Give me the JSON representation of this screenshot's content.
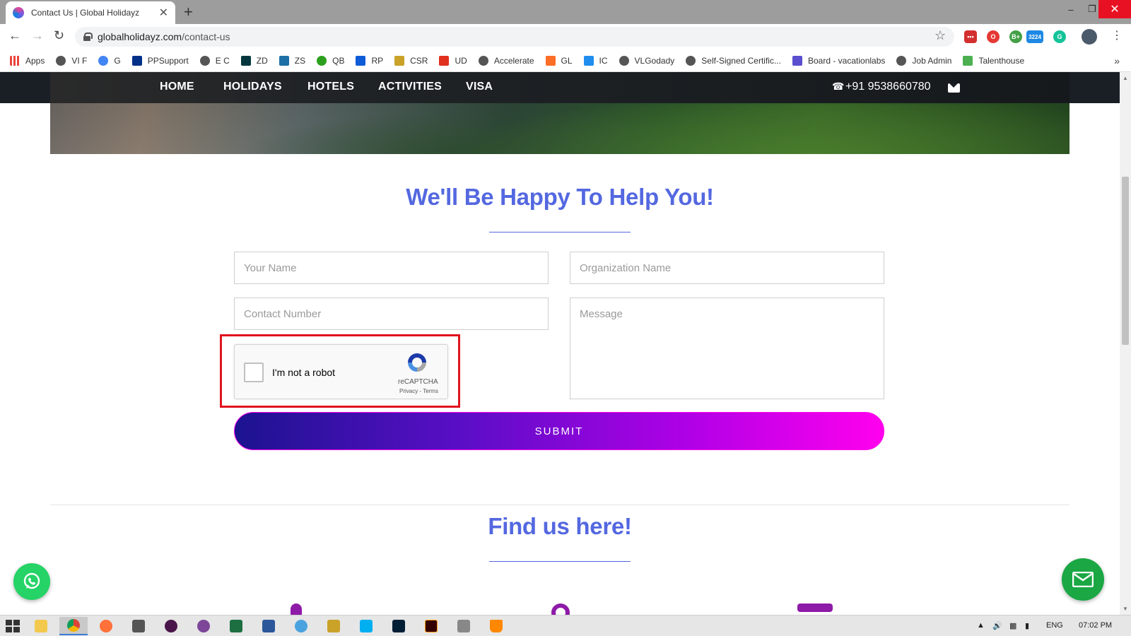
{
  "browser": {
    "tab_title": "Contact Us | Global Holidayz",
    "tab_close": "✕",
    "new_tab": "+",
    "url_domain": "globalholidayz.com",
    "url_path": "/contact-us",
    "window_controls": {
      "minimize": "–",
      "restore": "❐",
      "close": "✕"
    },
    "extension_badge": "3224",
    "bookmarks": [
      {
        "label": "Apps",
        "icon": "apps-grid-icon",
        "color": "#e8453c"
      },
      {
        "label": "VI F",
        "icon": "globe-icon",
        "color": "#555555"
      },
      {
        "label": "G",
        "icon": "google-icon",
        "color": "#4285f4"
      },
      {
        "label": "PPSupport",
        "icon": "paypal-icon",
        "color": "#003087"
      },
      {
        "label": "E C",
        "icon": "globe-icon",
        "color": "#555555"
      },
      {
        "label": "ZD",
        "icon": "zendesk-icon",
        "color": "#03363d"
      },
      {
        "label": "ZS",
        "icon": "zenserp-icon",
        "color": "#1d6fa5"
      },
      {
        "label": "QB",
        "icon": "quickbooks-icon",
        "color": "#2ca01c"
      },
      {
        "label": "RP",
        "icon": "rp-icon",
        "color": "#0e5bd8"
      },
      {
        "label": "CSR",
        "icon": "lock-icon",
        "color": "#c9a227"
      },
      {
        "label": "UD",
        "icon": "ud-icon",
        "color": "#e0301e"
      },
      {
        "label": "Accelerate",
        "icon": "globe-icon",
        "color": "#555555"
      },
      {
        "label": "GL",
        "icon": "gitlab-icon",
        "color": "#fc6d26"
      },
      {
        "label": "IC",
        "icon": "intercom-icon",
        "color": "#1f8ded"
      },
      {
        "label": "VLGodady",
        "icon": "globe-icon",
        "color": "#555555"
      },
      {
        "label": "Self-Signed Certific...",
        "icon": "globe-icon",
        "color": "#555555"
      },
      {
        "label": "Board - vacationlabs",
        "icon": "z-icon",
        "color": "#5a4fcf"
      },
      {
        "label": "Job Admin",
        "icon": "globe-icon",
        "color": "#555555"
      },
      {
        "label": "Talenthouse",
        "icon": "talenthouse-icon",
        "color": "#4caf50"
      }
    ],
    "bookmarks_more": "»"
  },
  "nav": {
    "items": [
      "HOME",
      "HOLIDAYS",
      "HOTELS",
      "ACTIVITIES",
      "VISA"
    ],
    "phone": "+91 9538660780"
  },
  "contact": {
    "heading": "We'll Be Happy To Help You!",
    "name_placeholder": "Your Name",
    "org_placeholder": "Organization Name",
    "phone_placeholder": "Contact Number",
    "message_placeholder": "Message",
    "submit_label": "SUBMIT",
    "captcha": {
      "label": "I'm not a robot",
      "brand": "reCAPTCHA",
      "terms": "Privacy - Terms"
    }
  },
  "find": {
    "heading": "Find us here!"
  },
  "taskbar": {
    "language": "ENG",
    "time": "07:02 PM"
  },
  "colors": {
    "heading": "#5468e0",
    "submit_start": "#1c1390",
    "submit_end": "#ff00ee",
    "highlight": "#e0141e",
    "whatsapp": "#25d366",
    "mail_fab": "#1aa744"
  }
}
